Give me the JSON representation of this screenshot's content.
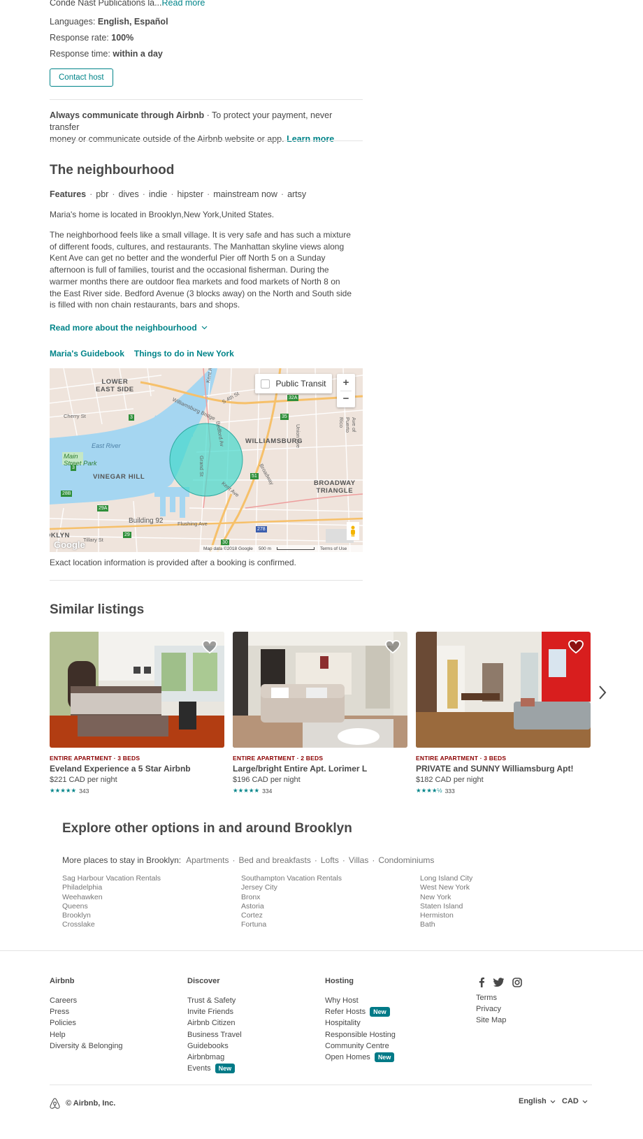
{
  "host": {
    "intro_truncated": "Conde Nast Publications la...",
    "read_more": "Read more",
    "languages_label": "Languages:",
    "languages_value": "English, Español",
    "response_rate_label": "Response rate:",
    "response_rate_value": "100%",
    "response_time_label": "Response time:",
    "response_time_value": "within a day",
    "contact_button": "Contact host"
  },
  "notice": {
    "bold": "Always communicate through Airbnb",
    "line1_rest": " · To protect your payment, never transfer",
    "line2": "money or communicate outside of the Airbnb website or app.",
    "learn_more": "Learn more"
  },
  "neighbourhood": {
    "title": "The neighbourhood",
    "features_label": "Features",
    "features": [
      "pbr",
      "dives",
      "indie",
      "hipster",
      "mainstream now",
      "artsy"
    ],
    "location": "Maria's home is located in Brooklyn,New York,United States.",
    "description_lines": [
      "The neighborhood feels like a small village. It is very safe and has such a mixture",
      "of different foods, cultures, and restaurants. The Manhattan skyline views along",
      "Kent Ave can get no better and the wonderful Pier off North 5 on a Sunday",
      "afternoon is full of families, tourist and the occasional fisherman. During the",
      "warmer months there are outdoor flea markets and food markets of North 8 on",
      "the East River side. Bedford Avenue (3 blocks away) on the North and South side",
      "is filled with non chain restaurants, bars and shops."
    ],
    "read_more": "Read more about the neighbourhood",
    "guidebook_link": "Maria's Guidebook",
    "things_link": "Things to do in New York",
    "map": {
      "transit_label": "Public Transit",
      "zoom_in": "+",
      "zoom_out": "−",
      "labels": {
        "lower_east_side_1": "LOWER",
        "lower_east_side_2": "EAST SIDE",
        "williamsburg": "WILLIAMSBURG",
        "vinegar_hill": "VINEGAR HILL",
        "broadway_1": "BROADWAY",
        "broadway_2": "TRIANGLE",
        "east_river": "East River",
        "main_street_1": "Main",
        "main_street_2": "Street Park",
        "building": "Building 92",
        "cherry": "Cherry St",
        "bridge": "Williamsburg Bridge",
        "flushing": "Flushing Ave",
        "tillary": "Tillary St",
        "bedford": "Bedford Av",
        "union": "Union Ave",
        "broadway": "Broadway",
        "kent": "Kent Ave",
        "kent_ave": "Kent Ave",
        "fourth": "S 4th St",
        "puerto": "Ave of Puerto Rico",
        "grand": "Grand St",
        "klyn": "OKLYN",
        "google": "Google",
        "attribution": "Map data ©2018 Google",
        "scale": "500 m",
        "terms": "Terms of Use",
        "shields": [
          "3",
          "35",
          "32A",
          "3",
          "51",
          "28B",
          "29A",
          "29",
          "278",
          "30"
        ]
      }
    },
    "disclaimer": "Exact location information is provided after a booking is confirmed."
  },
  "similar": {
    "title": "Similar listings",
    "listings": [
      {
        "kind": "ENTIRE APARTMENT · 3 BEDS",
        "name": "Eveland Experience a 5 Star Airbnb",
        "price": "$221 CAD",
        "per": "per night",
        "stars": "★★★★★",
        "reviews": "343"
      },
      {
        "kind": "ENTIRE APARTMENT · 2 BEDS",
        "name": "Large/bright Entire Apt. Lorimer L",
        "price": "$196 CAD",
        "per": "per night",
        "stars": "★★★★★",
        "reviews": "334"
      },
      {
        "kind": "ENTIRE APARTMENT · 3 BEDS",
        "name": "PRIVATE and SUNNY Williamsburg Apt!",
        "price": "$182 CAD",
        "per": "per night",
        "stars": "★★★★½",
        "reviews": "333"
      }
    ]
  },
  "explore": {
    "title": "Explore other options in and around Brooklyn",
    "more_label": "More places to stay in Brooklyn:",
    "more_types": [
      "Apartments",
      "Bed and breakfasts",
      "Lofts",
      "Villas",
      "Condominiums"
    ],
    "columns": [
      [
        "Sag Harbour Vacation Rentals",
        "Philadelphia",
        "Weehawken",
        "Queens",
        "Brooklyn",
        "Crosslake"
      ],
      [
        "Southampton Vacation Rentals",
        "Jersey City",
        "Bronx",
        "Astoria",
        "Cortez",
        "Fortuna"
      ],
      [
        "Long Island City",
        "West New York",
        "New York",
        "Staten Island",
        "Hermiston",
        "Bath"
      ]
    ]
  },
  "footer": {
    "airbnb": {
      "title": "Airbnb",
      "items": [
        "Careers",
        "Press",
        "Policies",
        "Help",
        "Diversity & Belonging"
      ]
    },
    "discover": {
      "title": "Discover",
      "items": [
        "Trust & Safety",
        "Invite Friends",
        "Airbnb Citizen",
        "Business Travel",
        "Guidebooks",
        "Airbnbmag",
        "Events"
      ]
    },
    "hosting": {
      "title": "Hosting",
      "items": [
        "Why Host",
        "Refer Hosts",
        "Hospitality",
        "Responsible Hosting",
        "Community Centre",
        "Open Homes"
      ]
    },
    "legal": [
      "Terms",
      "Privacy",
      "Site Map"
    ],
    "new_badge": "New",
    "copyright": "© Airbnb, Inc.",
    "language": "English",
    "currency": "CAD"
  }
}
